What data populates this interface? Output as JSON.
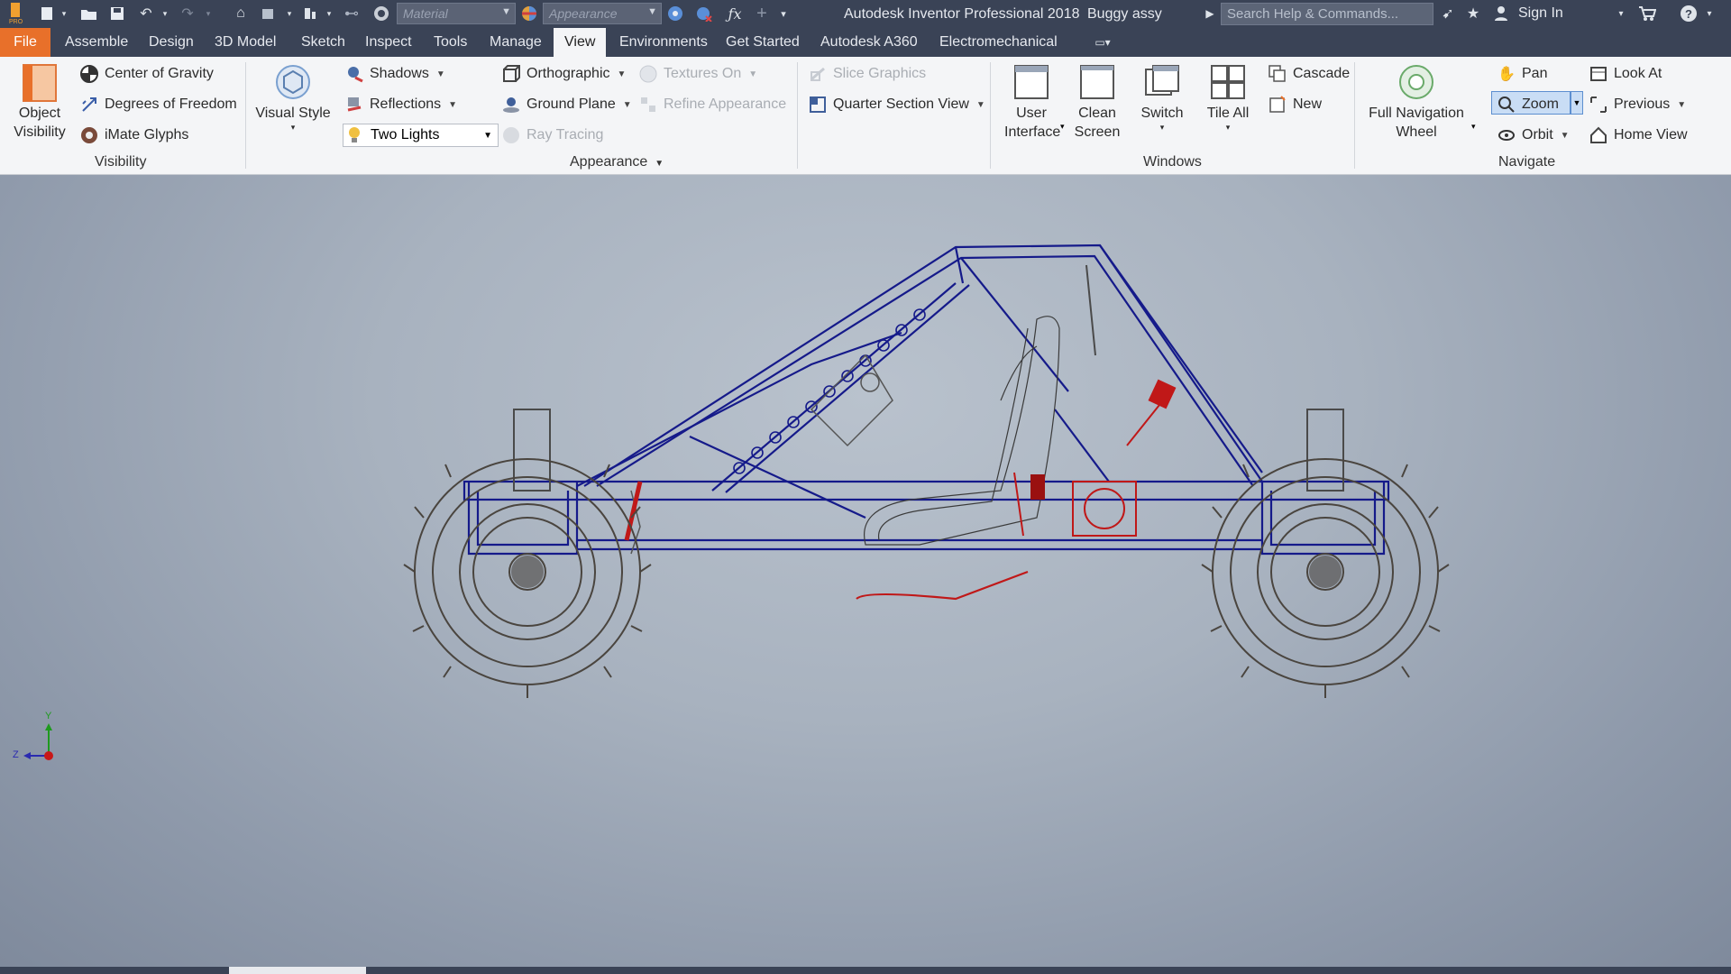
{
  "titlebar": {
    "material_placeholder": "Material",
    "appearance_placeholder": "Appearance",
    "app_title": "Autodesk Inventor Professional 2018",
    "doc_title": "Buggy assy",
    "search_placeholder": "Search Help & Commands...",
    "signin": "Sign In",
    "icons": [
      "app-logo-icon",
      "new-icon",
      "open-icon",
      "save-icon",
      "undo-icon",
      "redo-icon",
      "home-icon",
      "update-icon",
      "select-icon",
      "measure-icon",
      "color-icon",
      "fx-icon",
      "plus-icon",
      "search-options-icon",
      "star-icon",
      "user-icon",
      "cart-icon",
      "help-icon"
    ]
  },
  "menu": {
    "file": "File",
    "tabs": [
      "Assemble",
      "Design",
      "3D Model",
      "Sketch",
      "Inspect",
      "Tools",
      "Manage",
      "View",
      "Environments",
      "Get Started",
      "Autodesk A360",
      "Electromechanical"
    ],
    "active": "View"
  },
  "ribbon": {
    "visibility": {
      "object_visibility": "Object Visibility",
      "center_of_gravity": "Center of Gravity",
      "degrees_of_freedom": "Degrees of Freedom",
      "imate_glyphs": "iMate Glyphs",
      "label": "Visibility"
    },
    "appearance": {
      "visual_style": "Visual Style",
      "shadows": "Shadows",
      "reflections": "Reflections",
      "lighting": "Two Lights",
      "orthographic": "Orthographic",
      "ground_plane": "Ground Plane",
      "ray_tracing": "Ray Tracing",
      "textures_on": "Textures On",
      "refine_appearance": "Refine Appearance",
      "slice_graphics": "Slice Graphics",
      "quarter_section": "Quarter Section View",
      "label": "Appearance"
    },
    "windows": {
      "user_interface": "User Interface",
      "clean_screen": "Clean Screen",
      "switch": "Switch",
      "tile_all": "Tile All",
      "cascade": "Cascade",
      "new": "New",
      "label": "Windows"
    },
    "navigate": {
      "full_nav_wheel": "Full Navigation Wheel",
      "pan": "Pan",
      "zoom": "Zoom",
      "orbit": "Orbit",
      "look_at": "Look At",
      "previous": "Previous",
      "home_view": "Home View",
      "label": "Navigate"
    }
  },
  "viewport": {
    "model": "Buggy assy",
    "triad": {
      "y": "Y",
      "z": "Z"
    }
  }
}
